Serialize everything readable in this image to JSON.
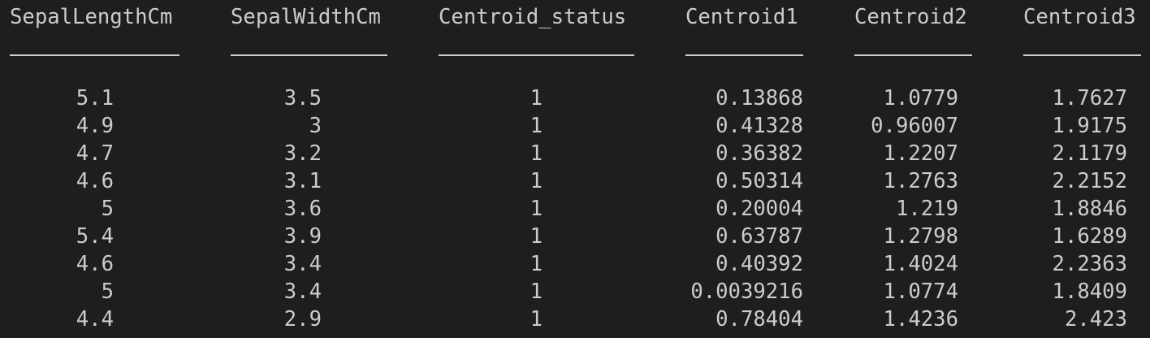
{
  "table": {
    "columns": [
      {
        "header": "SepalLengthCm",
        "values": [
          "5.1",
          "4.9",
          "4.7",
          "4.6",
          "5",
          "5.4",
          "4.6",
          "5",
          "4.4"
        ]
      },
      {
        "header": "SepalWidthCm",
        "values": [
          "3.5",
          "3",
          "3.2",
          "3.1",
          "3.6",
          "3.9",
          "3.4",
          "3.4",
          "2.9"
        ]
      },
      {
        "header": "Centroid_status",
        "values": [
          "1",
          "1",
          "1",
          "1",
          "1",
          "1",
          "1",
          "1",
          "1"
        ]
      },
      {
        "header": "Centroid1",
        "values": [
          "0.13868",
          "0.41328",
          "0.36382",
          "0.50314",
          "0.20004",
          "0.63787",
          "0.40392",
          "0.0039216",
          "0.78404"
        ]
      },
      {
        "header": "Centroid2",
        "values": [
          "1.0779",
          "0.96007",
          "1.2207",
          "1.2763",
          "1.219",
          "1.2798",
          "1.4024",
          "1.0774",
          "1.4236"
        ]
      },
      {
        "header": "Centroid3",
        "values": [
          "1.7627",
          "1.9175",
          "2.1179",
          "2.2152",
          "1.8846",
          "1.6289",
          "2.2363",
          "1.8409",
          "2.423"
        ]
      }
    ]
  }
}
